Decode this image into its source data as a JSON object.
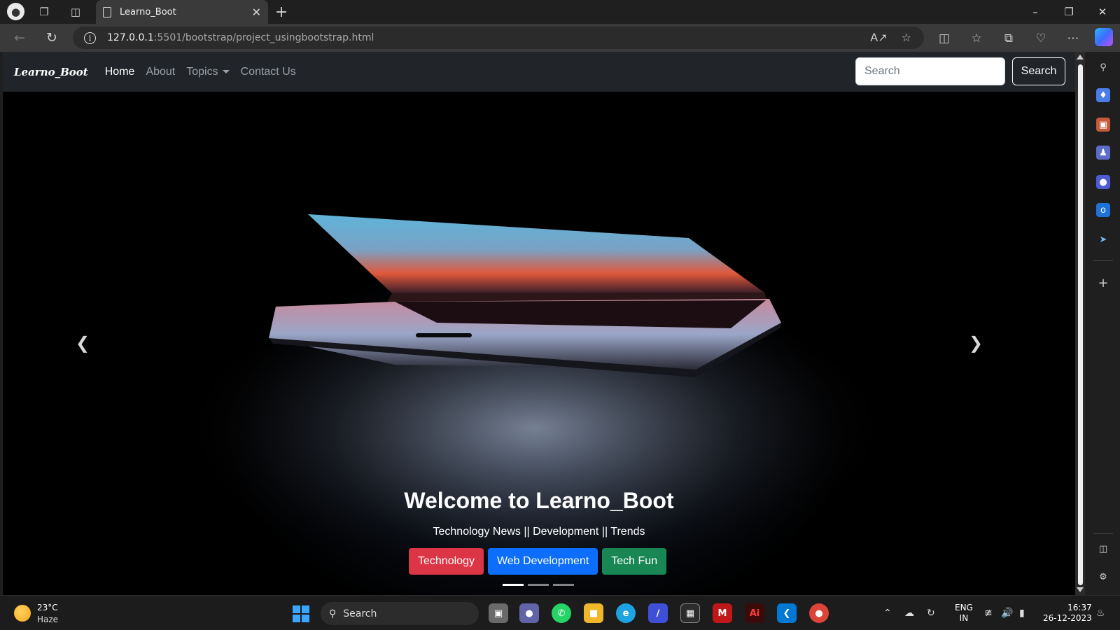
{
  "browser": {
    "tab_title": "Learno_Boot",
    "url_host": "127.0.0.1",
    "url_path": ":5501/bootstrap/project_usingbootstrap.html"
  },
  "site": {
    "brand": "Learno_Boot",
    "nav": {
      "home": "Home",
      "about": "About",
      "topics": "Topics",
      "contact": "Contact Us"
    },
    "search": {
      "placeholder": "Search",
      "button": "Search"
    },
    "carousel": {
      "title": "Welcome to Learno_Boot",
      "subtitle": "Technology News || Development || Trends",
      "buttons": {
        "technology": "Technology",
        "web_dev": "Web Development",
        "tech_fun": "Tech Fun"
      },
      "active_slide": 1,
      "slide_count": 3
    }
  },
  "taskbar": {
    "weather_temp": "23°C",
    "weather_desc": "Haze",
    "search_label": "Search",
    "lang_1": "ENG",
    "lang_2": "IN",
    "time": "16:37",
    "date": "26-12-2023"
  },
  "colors": {
    "danger": "#dc3545",
    "primary": "#0d6efd",
    "success": "#198754",
    "navbar": "#212529"
  },
  "icons": [
    "profile-icon",
    "workspaces-icon",
    "vertical-tabs-icon",
    "page-icon",
    "close-icon",
    "plus-icon",
    "back-icon",
    "refresh-icon",
    "info-icon",
    "read-aloud-icon",
    "favorite-star-icon",
    "split-screen-icon",
    "favorites-icon",
    "collections-icon",
    "browser-essentials-icon",
    "more-icon",
    "copilot-icon",
    "prev-arrow-icon",
    "next-arrow-icon",
    "windows-start-icon"
  ]
}
